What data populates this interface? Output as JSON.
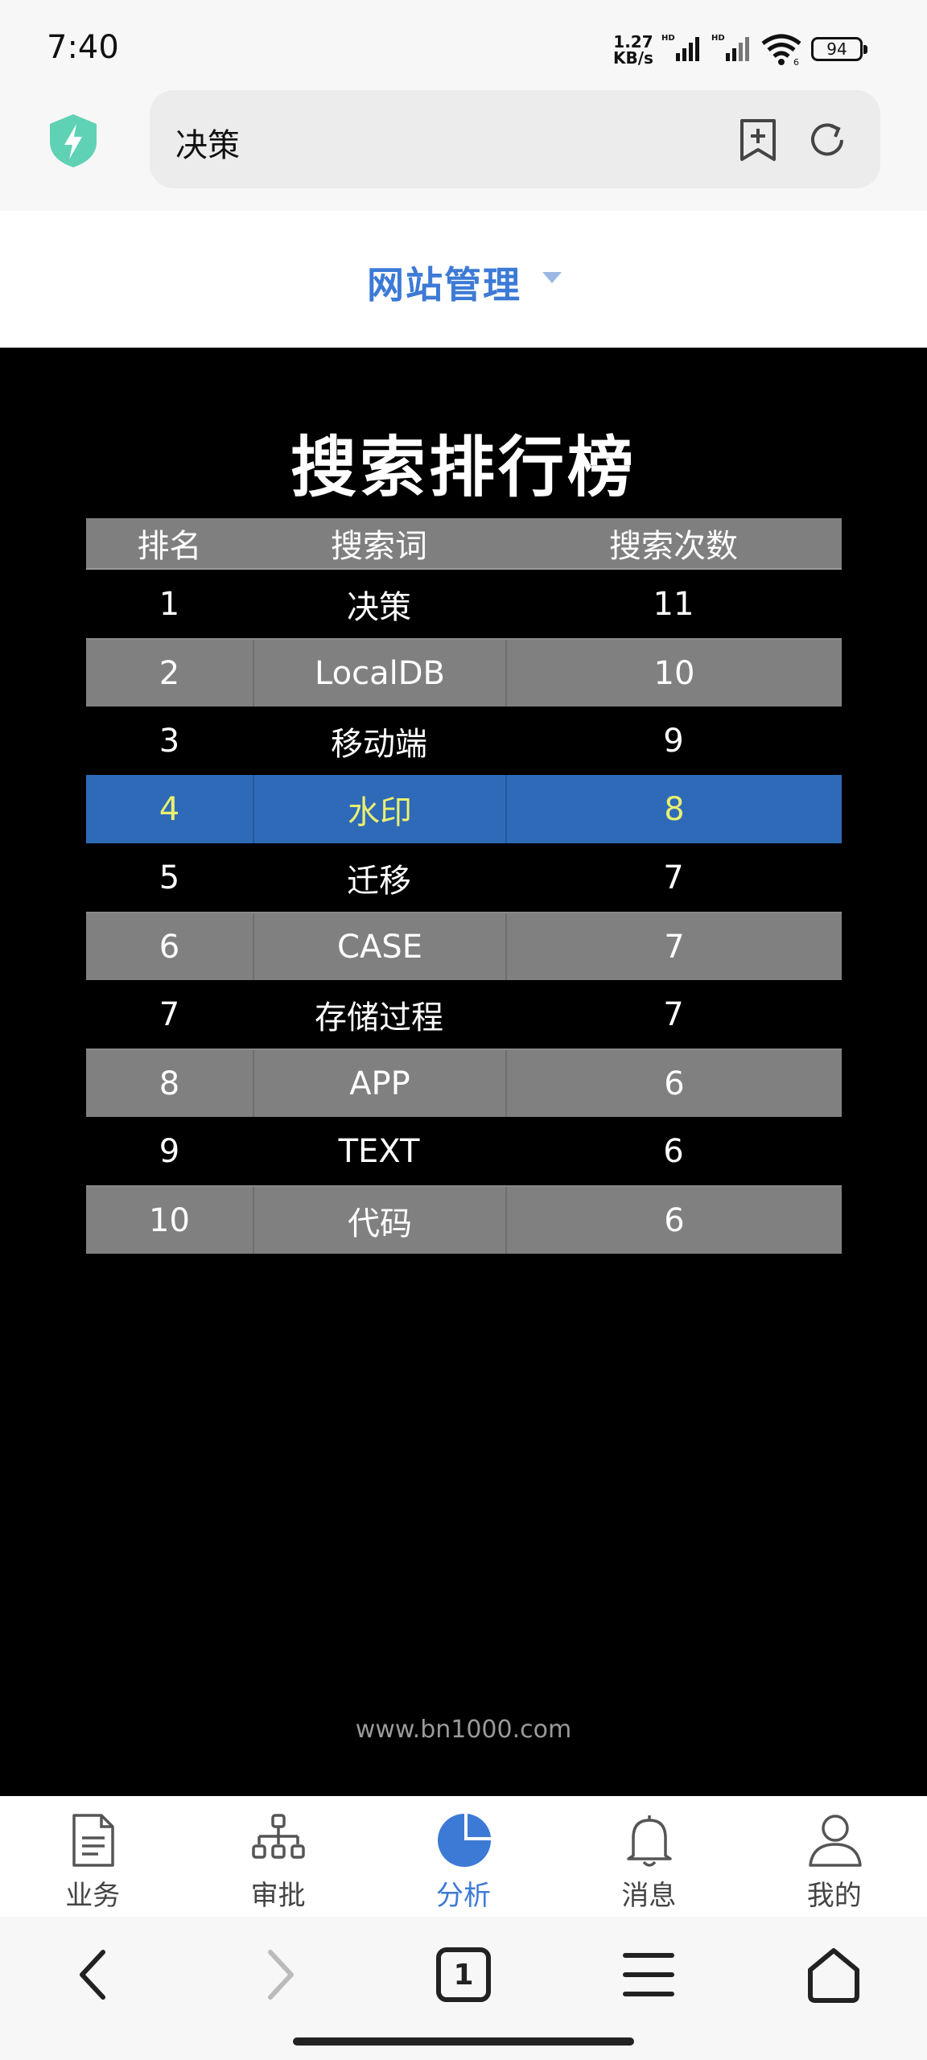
{
  "status": {
    "time": "7:40",
    "speed": "1.27",
    "speed_unit": "KB/s",
    "battery": "94"
  },
  "browser": {
    "url_text": "决策"
  },
  "site": {
    "label": "网站管理"
  },
  "board": {
    "title": "搜索排行榜",
    "columns": [
      "排名",
      "搜索词",
      "搜索次数"
    ],
    "rows": [
      [
        "1",
        "决策",
        "11"
      ],
      [
        "2",
        "LocalDB",
        "10"
      ],
      [
        "3",
        "移动端",
        "9"
      ],
      [
        "4",
        "水印",
        "8"
      ],
      [
        "5",
        "迁移",
        "7"
      ],
      [
        "6",
        "CASE",
        "7"
      ],
      [
        "7",
        "存储过程",
        "7"
      ],
      [
        "8",
        "APP",
        "6"
      ],
      [
        "9",
        "TEXT",
        "6"
      ],
      [
        "10",
        "代码",
        "6"
      ]
    ],
    "selected_rank": "4"
  },
  "footer": {
    "url": "www.bn1000.com"
  },
  "tabs": [
    {
      "label": "业务",
      "icon": "document-icon"
    },
    {
      "label": "审批",
      "icon": "org-chart-icon"
    },
    {
      "label": "分析",
      "icon": "pie-chart-icon",
      "active": true
    },
    {
      "label": "消息",
      "icon": "bell-icon"
    },
    {
      "label": "我的",
      "icon": "user-icon"
    }
  ],
  "nav": {
    "tab_count": "1"
  },
  "colors": {
    "accent": "#3d7ad6",
    "selected_row": "#2e6ab8",
    "selected_text": "#e9f06f",
    "gray_row": "#808080"
  }
}
